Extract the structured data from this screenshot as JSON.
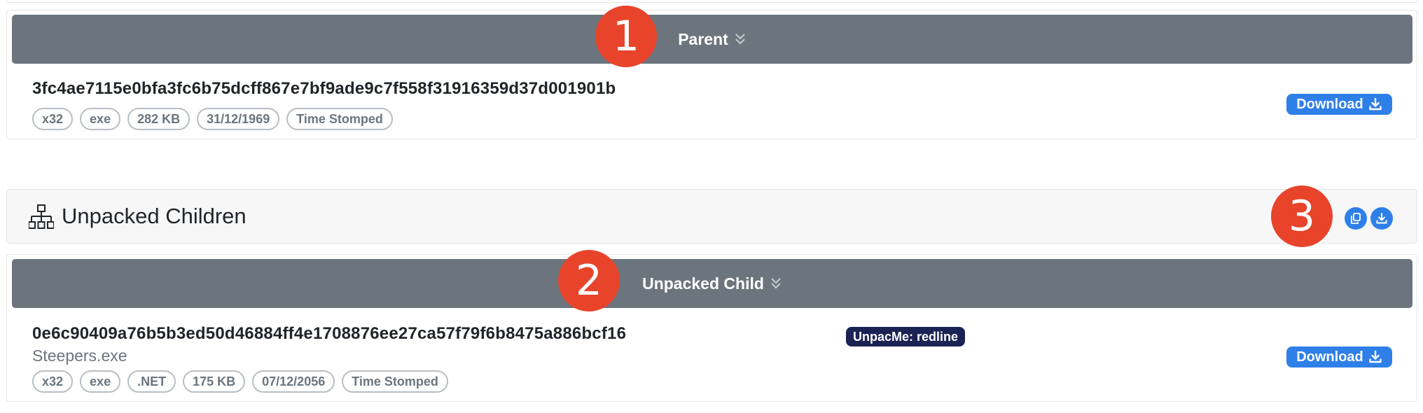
{
  "parent": {
    "header_label": "Parent",
    "hash": "3fc4ae7115e0bfa3fc6b75dcff867e7bf9ade9c7f558f31916359d37d001901b",
    "tags": [
      "x32",
      "exe",
      "282 KB",
      "31/12/1969",
      "Time Stomped"
    ],
    "download_label": "Download"
  },
  "children": {
    "title": "Unpacked Children"
  },
  "child": {
    "header_label": "Unpacked Child",
    "hash": "0e6c90409a76b5b3ed50d46884ff4e1708876ee27ca57f79f6b8475a886bcf16",
    "filename": "Steepers.exe",
    "badge": "UnpacMe: redline",
    "tags": [
      "x32",
      "exe",
      ".NET",
      "175 KB",
      "07/12/2056",
      "Time Stomped"
    ],
    "download_label": "Download"
  },
  "markers": [
    "1",
    "2",
    "3"
  ],
  "colors": {
    "bar": "#6c757d",
    "primary": "#2f7fe9",
    "marker": "#e8442b",
    "badge_dark": "#1b2254"
  },
  "icons": {
    "chevrons": "chevron-double-down-icon",
    "download": "download-icon",
    "sitemap": "sitemap-icon",
    "copy": "copy-icon"
  }
}
